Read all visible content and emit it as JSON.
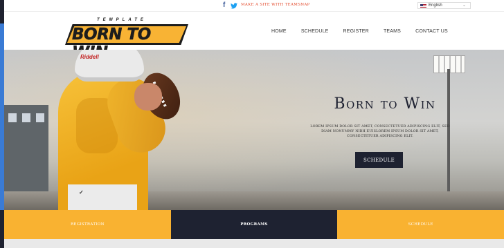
{
  "topbar": {
    "promo": "Make a site with TeamSnap",
    "language": "English"
  },
  "logo": {
    "small": "TEMPLATE",
    "word": "BORN TO WIN"
  },
  "nav": [
    "HOME",
    "SCHEDULE",
    "REGISTER",
    "TEAMS",
    "CONTACT US"
  ],
  "hero": {
    "title": "Born to Win",
    "text": "LOREM IPSUM DOLOR SIT AMET, CONSECTETUER ADIPISCING ELIT, SED DIAM NONUMMY NIBH EUISLOREM IPSUM DOLOR SIT AMET, CONSECTETUER ADIPISCING ELIT.",
    "button": "SCHEDULE",
    "helmet_brand": "Riddell",
    "pants_logo": "✓"
  },
  "tiles": [
    "Registration",
    "Programs",
    "Schedule"
  ],
  "colors": {
    "gold": "#f9b231",
    "navy": "#1e2231",
    "accent": "#e34a2c"
  }
}
